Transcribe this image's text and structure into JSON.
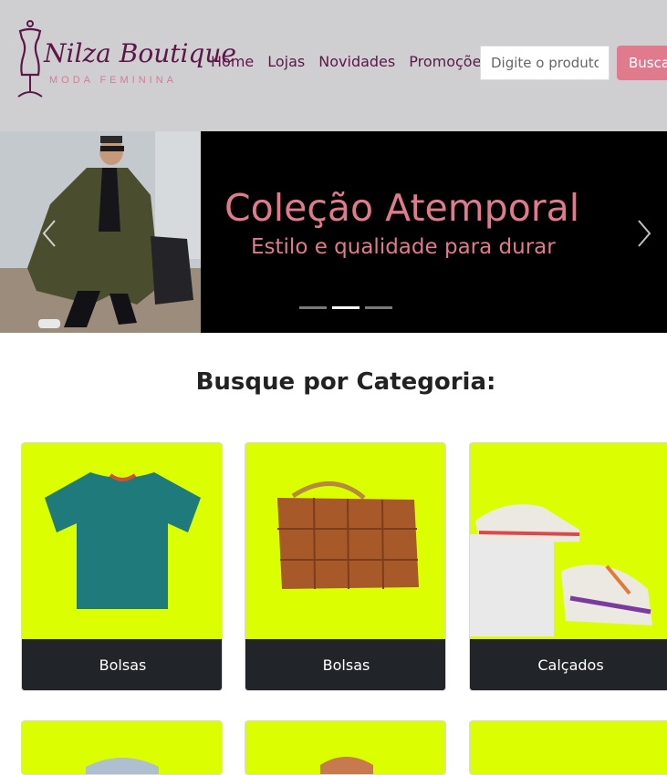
{
  "brand": {
    "name": "Nilza Boutique",
    "tagline": "MODA FEMININA"
  },
  "nav": {
    "items": [
      {
        "label": "Home"
      },
      {
        "label": "Lojas"
      },
      {
        "label": "Novidades"
      },
      {
        "label": "Promoções"
      }
    ]
  },
  "search": {
    "placeholder": "Digite o produto",
    "button_label": "Buscar"
  },
  "carousel": {
    "title": "Coleção Atemporal",
    "caption": "Estilo e qualidade para durar",
    "slide_count": 3,
    "active_slide": 2
  },
  "categories": {
    "title": "Busque por Categoria:",
    "items": [
      {
        "label": "Bolsas",
        "image": "teal t-shirt"
      },
      {
        "label": "Bolsas",
        "image": "brown woven leather bag"
      },
      {
        "label": "Calçados",
        "image": "sneakers"
      }
    ]
  },
  "colors": {
    "header_bg": "#cfcfd1",
    "brand_plum": "#5c1748",
    "accent_pink": "#e07b8d",
    "card_bg": "#dcff00",
    "card_footer": "#212529"
  }
}
